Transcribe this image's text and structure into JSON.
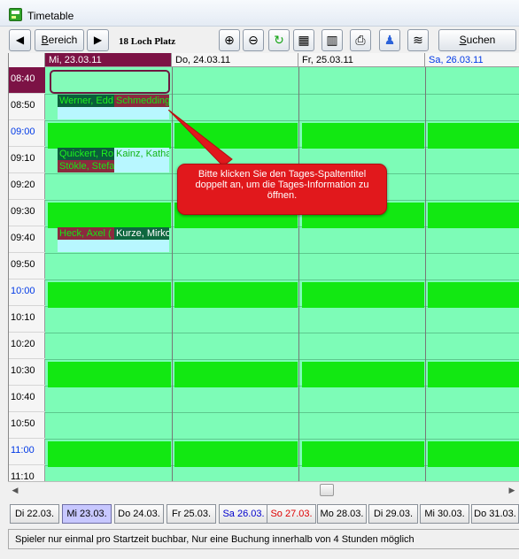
{
  "window": {
    "title": "Timetable"
  },
  "toolbar": {
    "range_label_prefix": "B",
    "range_label_rest": "ereich",
    "place": "18 Loch Platz",
    "search_prefix": "S",
    "search_rest": "uchen"
  },
  "columns": [
    "Mi, 23.03.11",
    "Do, 24.03.11",
    "Fr, 25.03.11",
    "Sa, 26.03.11"
  ],
  "times": [
    "08:40",
    "08:50",
    "09:00",
    "09:10",
    "09:20",
    "09:30",
    "09:40",
    "09:50",
    "10:00",
    "10:10",
    "10:20",
    "10:30",
    "10:40",
    "10:50",
    "11:00",
    "11:10"
  ],
  "bookings": {
    "r1c1a": "Werner, Edd",
    "r1c1b": "Schmedding,",
    "r3c1a": "Quickert, Ro",
    "r3c1b": "Kainz, Katha",
    "r3c1c": "Stökle, Stefa",
    "r6c1a": "Heck, Axel (",
    "r6c1b": "Kurze, Mirko"
  },
  "tooltip": {
    "text": "Bitte klicken Sie den Tages-Spaltentitel doppelt an, um die Tages-Information zu öffnen."
  },
  "days": [
    "Di 22.03.",
    "Mi 23.03.",
    "Do 24.03.",
    "Fr 25.03.",
    "Sa 26.03.",
    "So 27.03.",
    "Mo 28.03.",
    "Di 29.03.",
    "Mi 30.03.",
    "Do 31.03."
  ],
  "status": {
    "text": "Spieler nur einmal pro Startzeit buchbar, Nur eine Buchung innerhalb von 4 Stunden möglich"
  },
  "colors": {
    "active_header": "#7c1245",
    "grid_bg": "#7dfcb7",
    "slot_green": "#12e812",
    "tooltip": "#e1181c"
  }
}
